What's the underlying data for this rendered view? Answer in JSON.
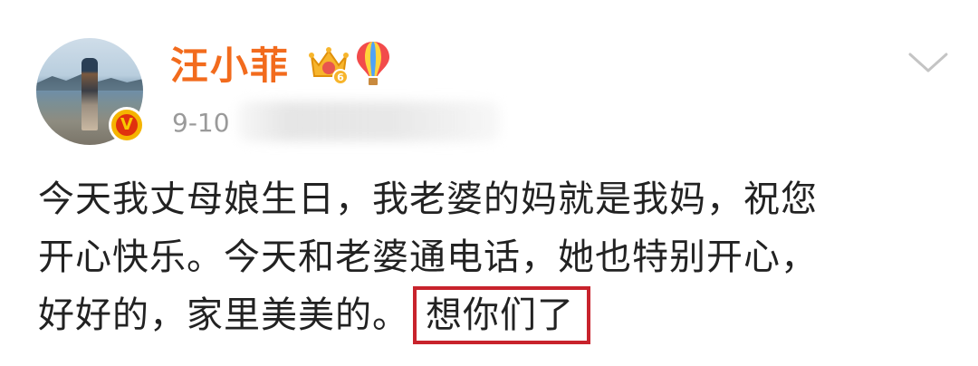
{
  "post": {
    "author": {
      "name": "汪小菲",
      "avatar_icon": "avatar-photo",
      "verified_icon": "verified-v-icon",
      "badges": [
        "crown-vip-icon",
        "hot-air-balloon-icon"
      ],
      "verified_letter": "V",
      "crown_level": "6"
    },
    "timestamp": "9-10",
    "menu_icon": "chevron-down-icon",
    "content": {
      "line1": "今天我丈母娘生日，我老婆的妈就是我妈，祝您",
      "line2": "开心快乐。今天和老婆通电话，她也特别开心，",
      "line3_prefix": "好好的，家里美美的。",
      "line3_highlight": "想你们了"
    }
  },
  "colors": {
    "username": "#f26b1d",
    "timestamp": "#9a9a9a",
    "text": "#222222",
    "highlight_border": "#c8232c",
    "verified_bg": "#e0310e",
    "verified_ring": "#f5b400"
  }
}
